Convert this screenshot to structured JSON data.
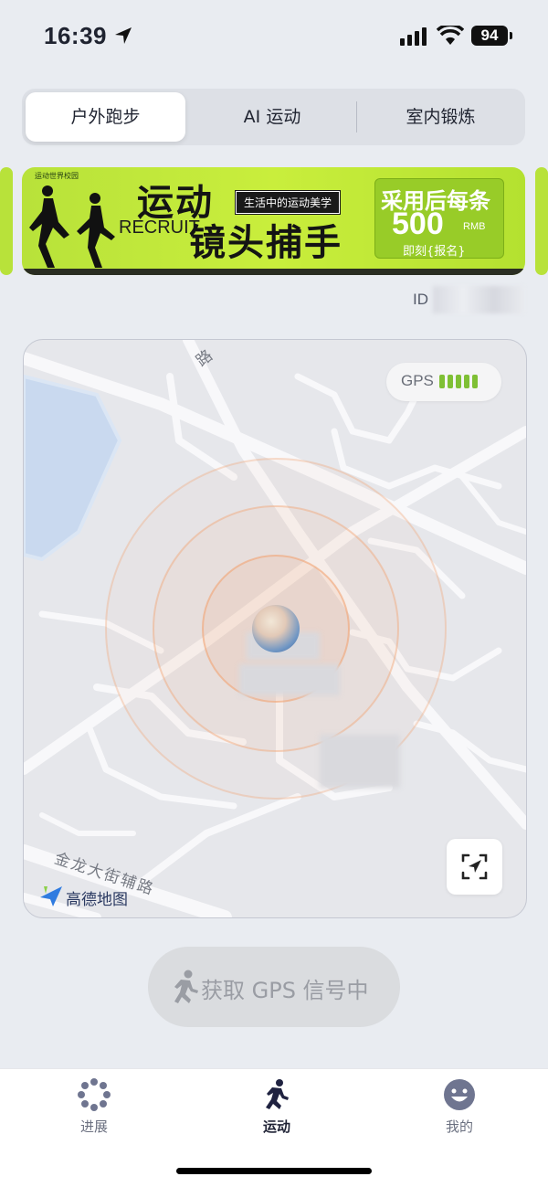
{
  "status_bar": {
    "time": "16:39",
    "battery": "94"
  },
  "tabs": [
    {
      "label": "户外跑步",
      "active": true
    },
    {
      "label": "AI 运动",
      "active": false
    },
    {
      "label": "室内锻炼",
      "active": false
    }
  ],
  "banner": {
    "brand": "运动世界校园",
    "title_line1": "运动",
    "recruit": "RECRUIT",
    "title_line2": "镜头捕手",
    "tag": "生活中的运动美学",
    "offer_line1": "采用后每条",
    "offer_amount": "500",
    "offer_unit": "RMB",
    "offer_cta": "即刻{报名}"
  },
  "user": {
    "id_label": "ID"
  },
  "map": {
    "gps_label": "GPS",
    "gps_strength_bars": 5,
    "provider": "高德地图",
    "road_labels": [
      "路",
      "金龙大街辅路"
    ]
  },
  "action_button": {
    "label": "获取 GPS 信号中"
  },
  "bottom_nav": [
    {
      "label": "进展",
      "active": false,
      "icon": "progress-dots-icon"
    },
    {
      "label": "运动",
      "active": true,
      "icon": "runner-icon"
    },
    {
      "label": "我的",
      "active": false,
      "icon": "smiley-face-icon"
    }
  ],
  "colors": {
    "background": "#e9ecf1",
    "banner_green": "#c9ee3c",
    "gps_green": "#7fc035",
    "ring_orange": "#f2a473"
  }
}
